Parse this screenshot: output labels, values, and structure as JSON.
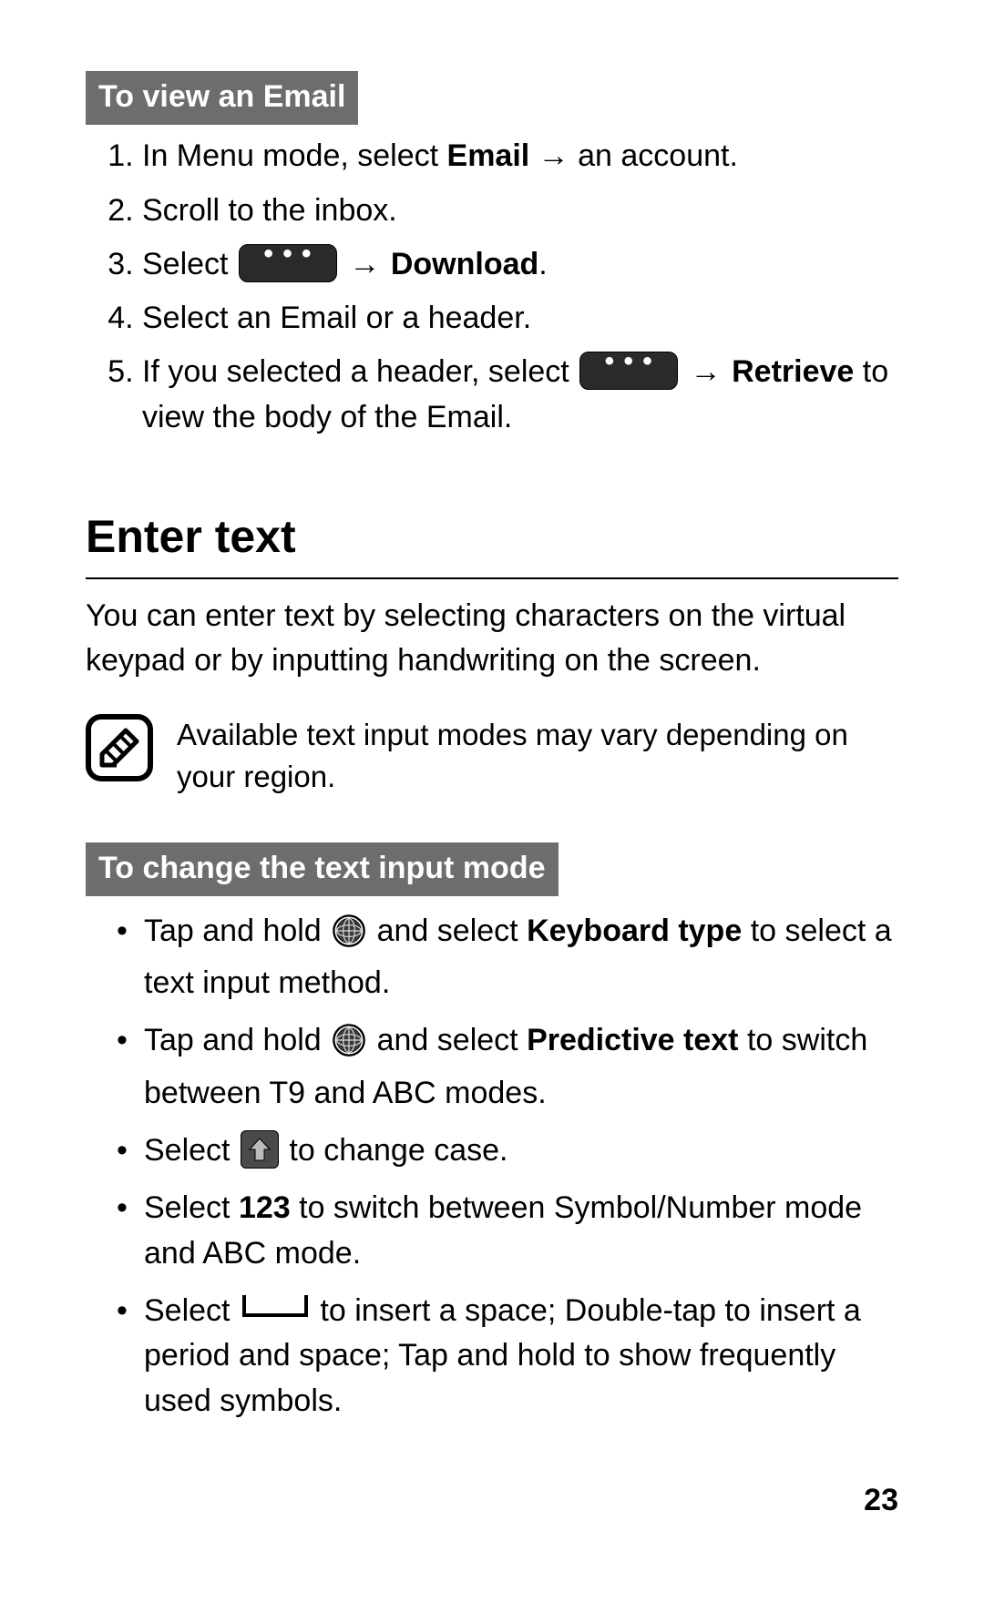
{
  "section1": {
    "heading": "To view an Email",
    "steps": {
      "s1_pre": "In Menu mode, select ",
      "s1_bold": "Email",
      "s1_post": " → an account.",
      "s2": "Scroll to the inbox.",
      "s3_pre": "Select ",
      "s3_arrow": " → ",
      "s3_bold": "Download",
      "s3_period": ".",
      "s4": "Select an Email or a header.",
      "s5_pre": "If you selected a header, select ",
      "s5_arrow": " → ",
      "s5_bold": "Retrieve",
      "s5_post": " to view the body of the Email."
    }
  },
  "section2": {
    "title": "Enter text",
    "intro": "You can enter text by selecting characters on the virtual keypad or by inputting handwriting on the screen.",
    "note": "Available text input modes may vary depending on your region."
  },
  "section3": {
    "heading": "To change the text input mode",
    "bullets": {
      "b1_pre": "Tap and hold ",
      "b1_mid": " and select ",
      "b1_bold": "Keyboard type",
      "b1_post": " to select a text input method.",
      "b2_pre": "Tap and hold ",
      "b2_mid": " and select ",
      "b2_bold": "Predictive text",
      "b2_post": " to switch between T9 and ABC modes.",
      "b3_pre": "Select ",
      "b3_post": " to change case.",
      "b4_pre": "Select ",
      "b4_bold": "123",
      "b4_post": " to switch between Symbol/Number mode and ABC mode.",
      "b5_pre": "Select ",
      "b5_post": " to insert a space; Double-tap to insert a period and space; Tap and hold to show frequently used symbols."
    }
  },
  "page_number": "23"
}
